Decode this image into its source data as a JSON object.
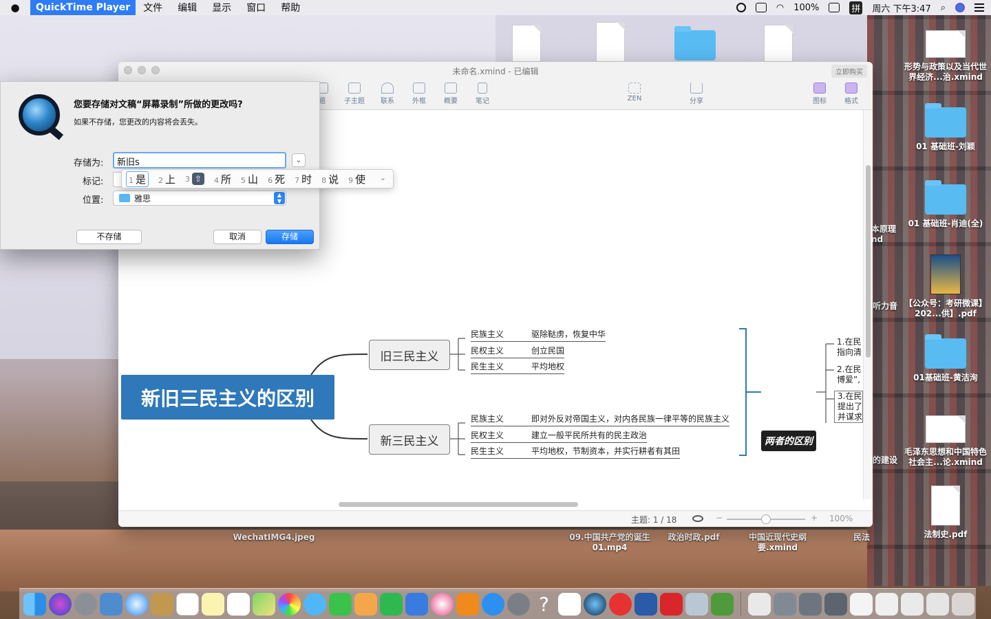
{
  "menubar": {
    "apple": "",
    "app_name": "QuickTime Player",
    "items": [
      "文件",
      "编辑",
      "显示",
      "窗口",
      "帮助"
    ],
    "battery": "100%",
    "input_method": "拼",
    "clock": "周六 下午3:47"
  },
  "xmind": {
    "title": "未命名.xmind - 已编辑",
    "buy": "立即购买",
    "toolbar": [
      "题",
      "子主题",
      "联系",
      "外框",
      "概要",
      "笔记",
      "ZEN",
      "分享",
      "图标",
      "格式"
    ],
    "status": {
      "topic_count": "主题: 1 / 18",
      "zoom": "100%"
    },
    "map": {
      "central": "新旧三民主义的区别",
      "old": {
        "label": "旧三民主义",
        "items": [
          {
            "k": "民族主义",
            "v": "驱除鞑虏，恢复中华"
          },
          {
            "k": "民权主义",
            "v": "创立民国"
          },
          {
            "k": "民生主义",
            "v": "平均地权"
          }
        ]
      },
      "new": {
        "label": "新三民主义",
        "items": [
          {
            "k": "民族主义",
            "v": "即对外反对帝国主义，对内各民族一律平等的民族主义"
          },
          {
            "k": "民权主义",
            "v": "建立一般平民所共有的民主政治"
          },
          {
            "k": "民生主义",
            "v": "平均地权，节制资本，并实行耕者有其田"
          }
        ]
      },
      "diff": {
        "label": "两者的区别",
        "notes": [
          "1.在民\n指向清",
          "2.在民\n博爱”,",
          "3.在民\n提出了\n并谋求"
        ]
      }
    }
  },
  "dialog": {
    "title": "您要存储对文稿“屏幕录制”所做的更改吗?",
    "subtitle": "如果不存储，您更改的内容将会丢失。",
    "save_as_label": "存储为:",
    "save_as_value": "新旧s",
    "tags_label": "标记:",
    "location_label": "位置:",
    "location_value": "雅思",
    "dont_save": "不存储",
    "cancel": "取消",
    "save": "存储"
  },
  "ime": {
    "candidates": [
      {
        "n": "1",
        "t": "是"
      },
      {
        "n": "2",
        "t": "上"
      },
      {
        "n": "3",
        "t": "⇧"
      },
      {
        "n": "4",
        "t": "所"
      },
      {
        "n": "5",
        "t": "山"
      },
      {
        "n": "6",
        "t": "死"
      },
      {
        "n": "7",
        "t": "时"
      },
      {
        "n": "8",
        "t": "说"
      },
      {
        "n": "9",
        "t": "使"
      }
    ]
  },
  "desktop": {
    "right_icons": [
      "形势与政策以及当代世界经济...治.xmind",
      "01 基础班-刘颖",
      "01 基础班-肖迪(全)",
      "【公众号：考研微课】202...供】.pdf",
      "01基础班-黄洁洵",
      "毛泽东思想和中国特色社会主...论.xmind",
      "法制史.pdf"
    ],
    "partial_labels": [
      "本原理\nnd",
      "听力音",
      "的建设"
    ],
    "bottom_icons": [
      "WechatIMG4.jpeg",
      "09.中国共产党的诞生01.mp4",
      "政治时政.pdf",
      "中国近现代史纲要.xmind",
      "民法"
    ]
  }
}
